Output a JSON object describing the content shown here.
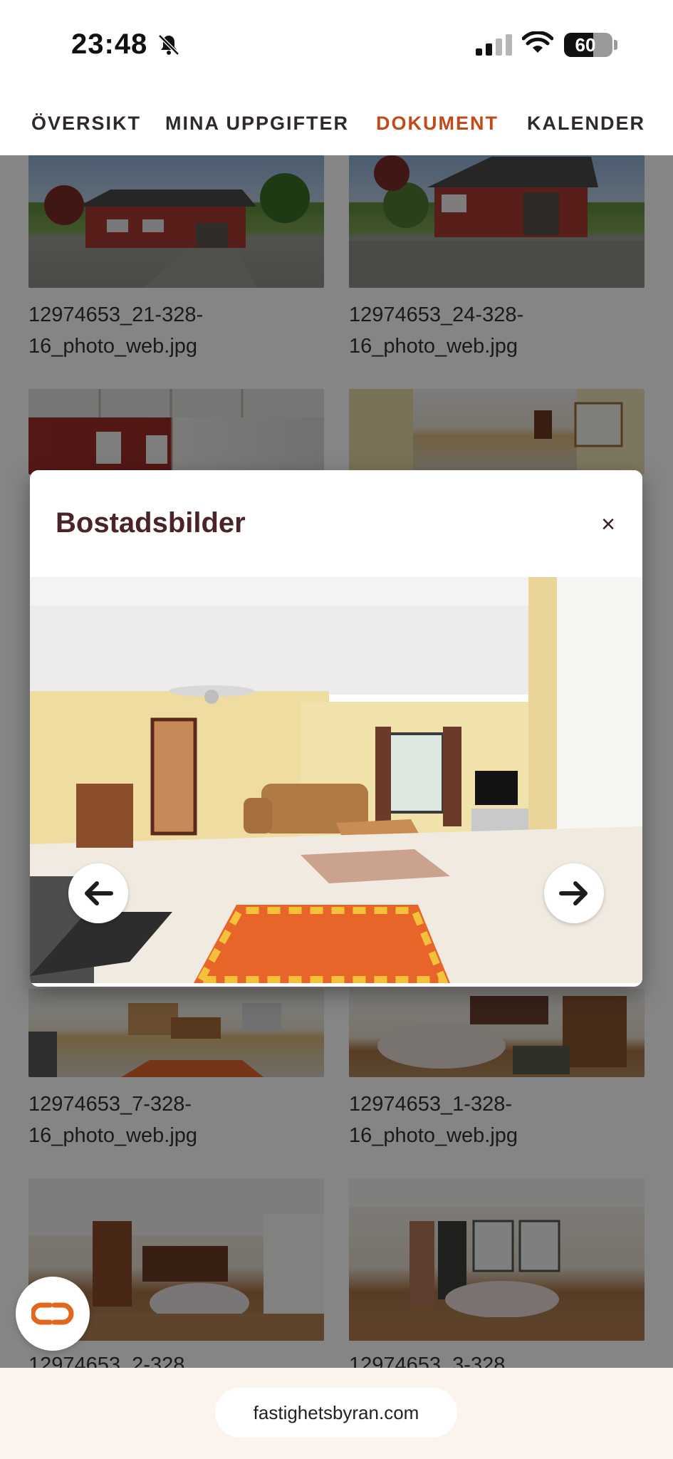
{
  "status_bar": {
    "time": "23:48",
    "battery": "60",
    "bell_icon": "bell-slash-icon",
    "signal_icon": "signal-icon",
    "wifi_icon": "wifi-icon"
  },
  "nav": {
    "items": [
      {
        "label": "ÖVERSIKT",
        "active": false
      },
      {
        "label": "MINA UPPGIFTER",
        "active": false
      },
      {
        "label": "DOKUMENT",
        "active": true
      },
      {
        "label": "KALENDER",
        "active": false
      }
    ],
    "active_color": "#c24a17"
  },
  "gallery": {
    "items": [
      {
        "filename": "12974653_21-328-16_photo_web.jpg",
        "caption_line1": "12974653_21-328-",
        "caption_line2": "16_photo_web.jpg"
      },
      {
        "filename": "12974653_24-328-16_photo_web.jpg",
        "caption_line1": "12974653_24-328-",
        "caption_line2": "16_photo_web.jpg"
      },
      {
        "filename": "",
        "caption_line1": "",
        "caption_line2": ""
      },
      {
        "filename": "",
        "caption_line1": "",
        "caption_line2": ""
      },
      {
        "filename": "12974653_7-328-16_photo_web.jpg",
        "caption_line1": "12974653_7-328-",
        "caption_line2": "16_photo_web.jpg"
      },
      {
        "filename": "12974653_1-328-16_photo_web.jpg",
        "caption_line1": "12974653_1-328-",
        "caption_line2": "16_photo_web.jpg"
      },
      {
        "filename": "12974653_2-328",
        "caption_line1": "12974653_2-328",
        "caption_line2": ""
      },
      {
        "filename": "12974653_3-328",
        "caption_line1": "12974653_3-328",
        "caption_line2": ""
      }
    ]
  },
  "modal": {
    "title": "Bostadsbilder",
    "close_label": "×",
    "prev_icon": "arrow-left-icon",
    "next_icon": "arrow-right-icon"
  },
  "browser": {
    "url": "fastighetsbyran.com"
  },
  "fab": {
    "icon": "chat-link-icon",
    "accent": "#e2671e"
  }
}
